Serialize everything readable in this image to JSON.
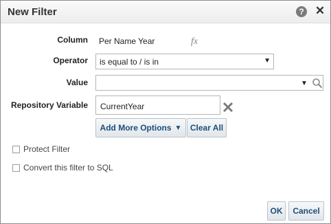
{
  "dialog": {
    "title": "New Filter",
    "help_glyph": "?",
    "close_glyph": "✕"
  },
  "form": {
    "column_label": "Column",
    "column_value": "Per Name Year",
    "fx_glyph": "fx",
    "operator_label": "Operator",
    "operator_value": "is equal to / is in",
    "value_label": "Value",
    "value_value": "",
    "repo_label": "Repository Variable",
    "repo_value": "CurrentYear"
  },
  "buttons": {
    "add_more_options": "Add More Options",
    "clear_all": "Clear All",
    "ok": "OK",
    "cancel": "Cancel"
  },
  "checkboxes": {
    "protect_filter": {
      "label": "Protect Filter",
      "checked": false
    },
    "convert_sql": {
      "label": "Convert this filter to SQL",
      "checked": false
    }
  },
  "icons": {
    "help": "help-icon",
    "close": "close-icon",
    "fx": "formula-icon",
    "search": "search-icon",
    "clear": "delete-x-icon",
    "dropdown": "triangle-down-icon"
  },
  "colors": {
    "button_text": "#1d4e78",
    "clear_x": "#7a7a7a"
  }
}
